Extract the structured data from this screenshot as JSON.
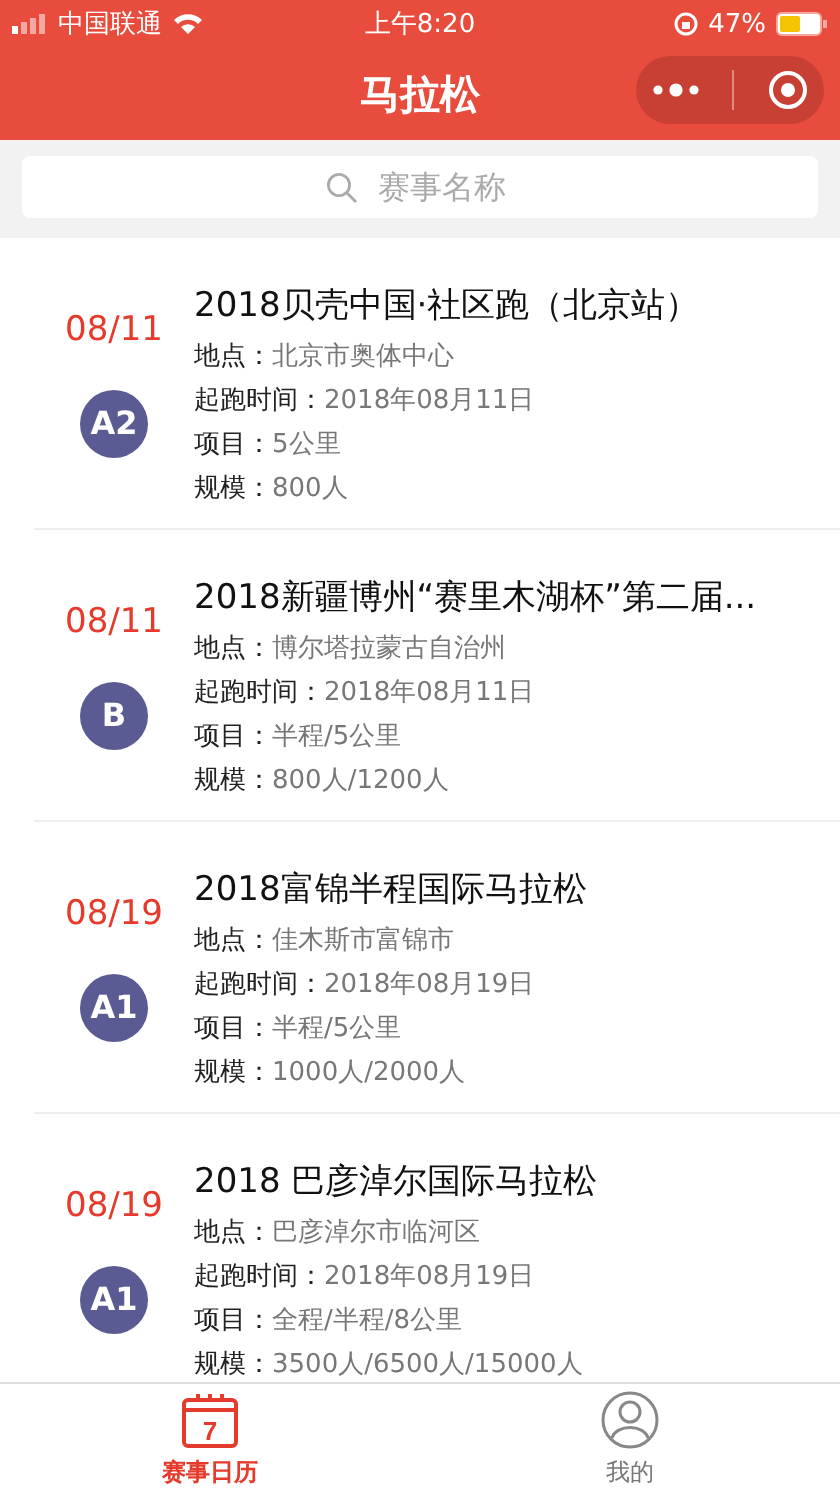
{
  "status_bar": {
    "carrier": "中国联通",
    "time": "上午8:20",
    "battery": "47%"
  },
  "nav": {
    "title": "马拉松"
  },
  "search": {
    "placeholder": "赛事名称"
  },
  "events": [
    {
      "date": "08/11",
      "grade": "A2",
      "title": "2018贝壳中国·社区跑（北京站）",
      "fields": [
        {
          "label": "地点：",
          "value": "北京市奥体中心"
        },
        {
          "label": "起跑时间：",
          "value": "2018年08月11日"
        },
        {
          "label": "项目：",
          "value": "5公里"
        },
        {
          "label": "规模：",
          "value": "800人"
        }
      ]
    },
    {
      "date": "08/11",
      "grade": "B",
      "title": "2018新疆博州“赛里木湖杯”第二届...",
      "fields": [
        {
          "label": "地点：",
          "value": "博尔塔拉蒙古自治州"
        },
        {
          "label": "起跑时间：",
          "value": "2018年08月11日"
        },
        {
          "label": "项目：",
          "value": "半程/5公里"
        },
        {
          "label": "规模：",
          "value": "800人/1200人"
        }
      ]
    },
    {
      "date": "08/19",
      "grade": "A1",
      "title": "2018富锦半程国际马拉松",
      "fields": [
        {
          "label": "地点：",
          "value": "佳木斯市富锦市"
        },
        {
          "label": "起跑时间：",
          "value": "2018年08月19日"
        },
        {
          "label": "项目：",
          "value": "半程/5公里"
        },
        {
          "label": "规模：",
          "value": "1000人/2000人"
        }
      ]
    },
    {
      "date": "08/19",
      "grade": "A1",
      "title": "2018 巴彦淖尔国际马拉松",
      "fields": [
        {
          "label": "地点：",
          "value": "巴彦淖尔市临河区"
        },
        {
          "label": "起跑时间：",
          "value": "2018年08月19日"
        },
        {
          "label": "项目：",
          "value": "全程/半程/8公里"
        },
        {
          "label": "规模：",
          "value": "3500人/6500人/15000人"
        }
      ]
    }
  ],
  "tabs": [
    {
      "label": "赛事日历",
      "kind": "calendar",
      "icon_text": "7",
      "selected": true
    },
    {
      "label": "我的",
      "kind": "profile",
      "selected": false
    }
  ]
}
